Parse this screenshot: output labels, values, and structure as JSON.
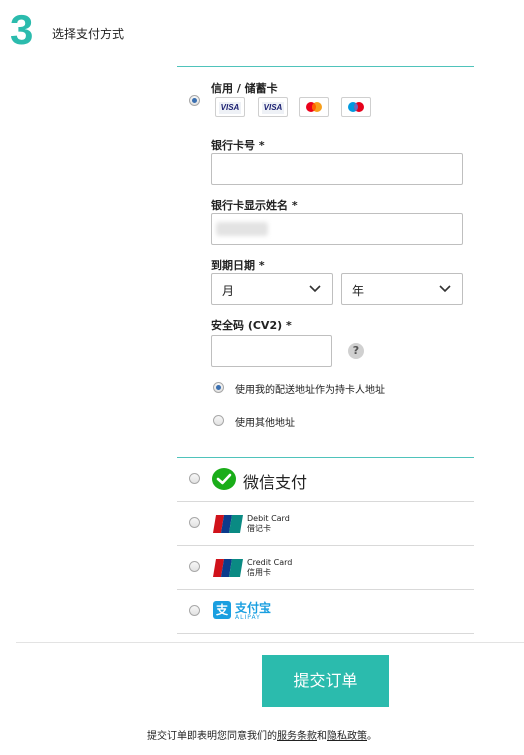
{
  "step": {
    "number": "3",
    "title": "选择支付方式"
  },
  "card_option": {
    "label": "信用 / 储蓄卡",
    "selected": true,
    "card_logos": [
      "visa-icon",
      "visa-electron-icon",
      "mastercard-icon",
      "maestro-icon"
    ],
    "visa_text": "VISA"
  },
  "form": {
    "card_number_label": "银行卡号 *",
    "card_number_value": "",
    "card_name_label": "银行卡显示姓名 *",
    "expiry_label": "到期日期 *",
    "month_value": "月",
    "year_value": "年",
    "cvv_label": "安全码 (CV2) *",
    "cvv_value": "",
    "help_symbol": "?"
  },
  "address_options": [
    {
      "label": "使用我的配送地址作为持卡人地址",
      "selected": true
    },
    {
      "label": "使用其他地址",
      "selected": false
    }
  ],
  "payment_methods": {
    "wechat": {
      "label": "微信支付"
    },
    "unionpay_debit": {
      "line1": "Debit Card",
      "line2": "借记卡"
    },
    "unionpay_credit": {
      "line1": "Credit Card",
      "line2": "信用卡"
    },
    "alipay": {
      "cn": "支付宝",
      "en": "ALIPAY"
    }
  },
  "submit_label": "提交订单",
  "terms": {
    "prefix": "提交订单即表明您同意我们的",
    "terms_link": "服务条款",
    "and": "和",
    "privacy_link": "隐私政策",
    "suffix": "。"
  },
  "colors": {
    "accent": "#2bbbad",
    "wechat": "#1aad19",
    "alipay": "#1a9fe0",
    "unionpay_red": "#d0121b"
  }
}
